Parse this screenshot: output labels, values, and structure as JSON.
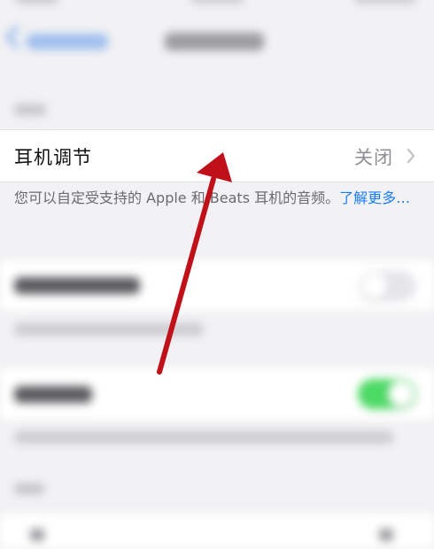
{
  "settings": {
    "headphone_row": {
      "label": "耳机调节",
      "value": "关闭"
    },
    "headphone_footer": {
      "text": "您可以自定受支持的 Apple 和 Beats 耳机的音频。",
      "link": "了解更多…"
    }
  },
  "colors": {
    "link": "#1a7cf2",
    "toggle_on": "#4cd964",
    "annotation_arrow": "#c0101a"
  },
  "icons": {
    "back": "chevron-left-icon",
    "disclosure": "chevron-right-icon"
  }
}
